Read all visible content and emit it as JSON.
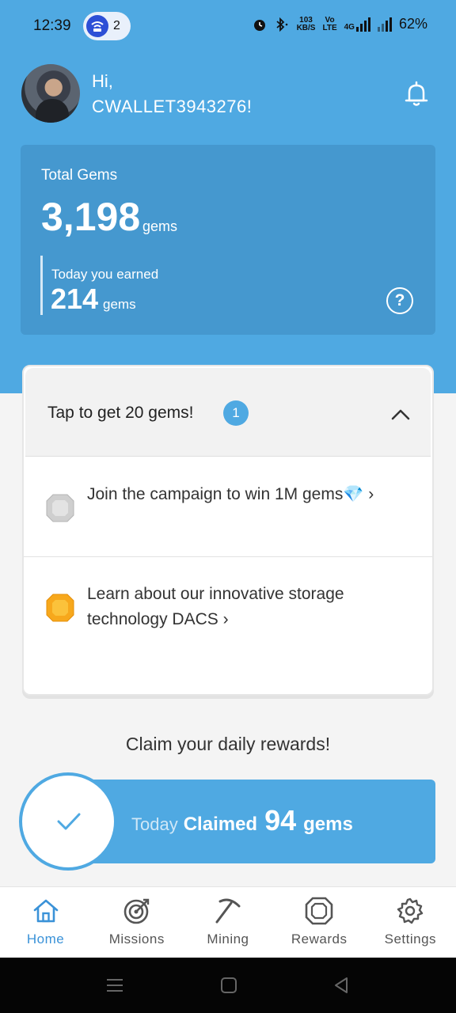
{
  "status_bar": {
    "time": "12:39",
    "notification_count": "2",
    "net_speed_top": "103",
    "net_speed_bottom": "KB/S",
    "volte_top": "Vo",
    "volte_bottom": "LTE",
    "network_type": "4G",
    "battery": "62%"
  },
  "header": {
    "greeting": "Hi,",
    "username": "CWALLET3943276!"
  },
  "gems_card": {
    "label": "Total Gems",
    "total": "3,198",
    "unit": "gems",
    "earned_label": "Today you earned",
    "earned_value": "214",
    "earned_unit": "gems",
    "help_symbol": "?"
  },
  "tasks": {
    "title": "Tap to get 20 gems!",
    "badge": "1",
    "items": [
      {
        "label": "Join the campaign to win 1M gems💎 ›",
        "icon": "silver-gem-icon"
      },
      {
        "label": "Learn about our innovative storage technology DACS ›",
        "icon": "gold-gem-icon"
      }
    ]
  },
  "claim": {
    "title": "Claim your daily rewards!",
    "today": "Today",
    "claimed": "Claimed",
    "amount": "94",
    "unit": "gems"
  },
  "bottom_nav": {
    "items": [
      {
        "label": "Home",
        "icon": "home-icon",
        "active": true
      },
      {
        "label": "Missions",
        "icon": "target-icon",
        "active": false
      },
      {
        "label": "Mining",
        "icon": "pickaxe-icon",
        "active": false
      },
      {
        "label": "Rewards",
        "icon": "gem-icon",
        "active": false
      },
      {
        "label": "Settings",
        "icon": "gear-icon",
        "active": false
      }
    ]
  },
  "colors": {
    "accent": "#4fa9e2",
    "card": "#4598cf",
    "nav_active": "#3a92d8"
  }
}
